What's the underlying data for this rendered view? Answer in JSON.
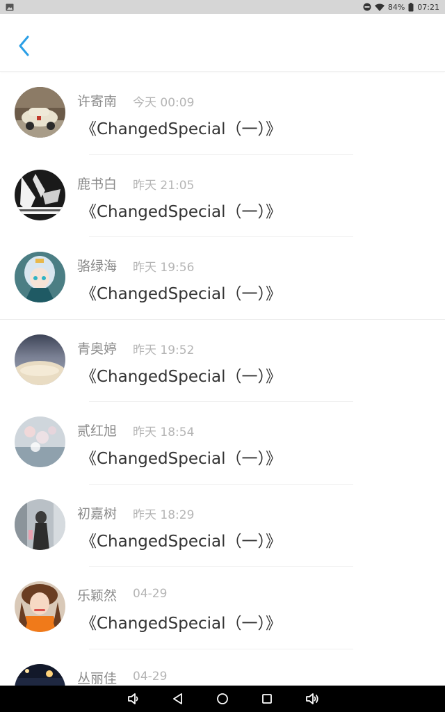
{
  "status_bar": {
    "battery": "84%",
    "clock": "07:21",
    "icons": [
      "gallery-icon",
      "do-not-disturb-icon",
      "wifi-icon",
      "battery-icon"
    ]
  },
  "header": {
    "back_icon": "chevron-left-icon",
    "accent_color": "#2b9fe6"
  },
  "messages": [
    {
      "name": "许寄南",
      "time": "今天 00:09",
      "title": "《ChangedSpecial（一）》"
    },
    {
      "name": "鹿书白",
      "time": "昨天 21:05",
      "title": "《ChangedSpecial（一）》"
    },
    {
      "name": "骆绿海",
      "time": "昨天 19:56",
      "title": "《ChangedSpecial（一）》"
    },
    {
      "name": "青奥婷",
      "time": "昨天 19:52",
      "title": "《ChangedSpecial（一）》"
    },
    {
      "name": "贰红旭",
      "time": "昨天 18:54",
      "title": "《ChangedSpecial（一）》"
    },
    {
      "name": "初嘉树",
      "time": "昨天 18:29",
      "title": "《ChangedSpecial（一）》"
    },
    {
      "name": "乐颖然",
      "time": "04-29",
      "title": "《ChangedSpecial（一）》"
    },
    {
      "name": "丛丽佳",
      "time": "04-29",
      "title": ""
    }
  ],
  "nav_bar": {
    "buttons": [
      "volume-down-icon",
      "back-icon",
      "home-icon",
      "recents-icon",
      "volume-up-icon"
    ]
  }
}
